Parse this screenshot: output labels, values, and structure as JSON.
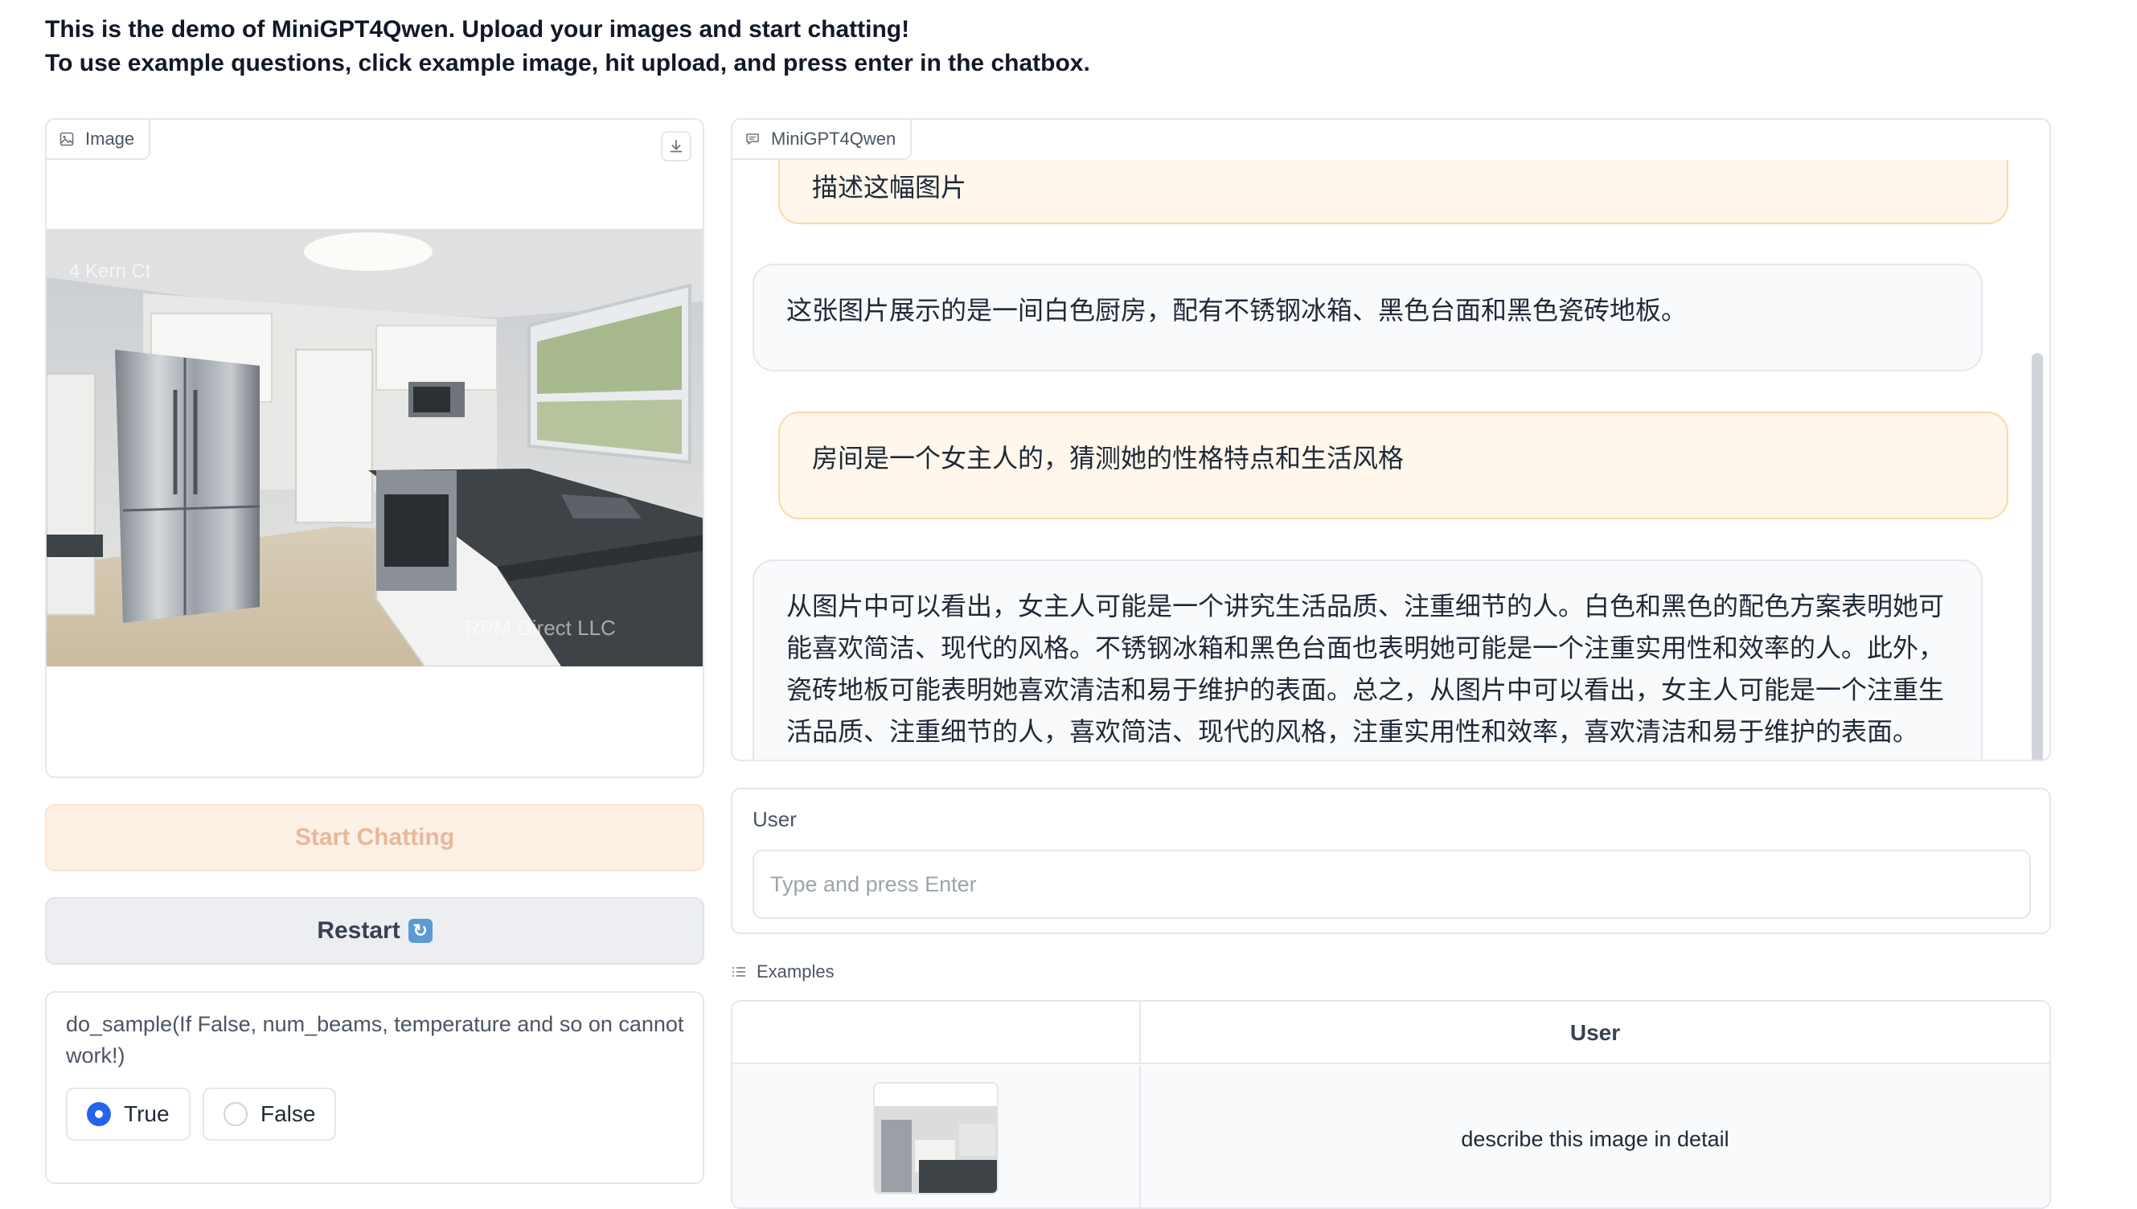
{
  "intro": {
    "line1": "This is the demo of MiniGPT4Qwen. Upload your images and start chatting!",
    "line2": "To use example questions, click example image, hit upload, and press enter in the chatbox."
  },
  "image_panel": {
    "label": "Image",
    "icons": [
      "image-icon",
      "download-icon"
    ]
  },
  "chatbot": {
    "label": "MiniGPT4Qwen",
    "messages": [
      {
        "role": "user",
        "text": "描述这幅图片"
      },
      {
        "role": "bot",
        "text": "这张图片展示的是一间白色厨房，配有不锈钢冰箱、黑色台面和黑色瓷砖地板。"
      },
      {
        "role": "user",
        "text": "房间是一个女主人的，猜测她的性格特点和生活风格"
      },
      {
        "role": "bot",
        "lines": [
          "从图片中可以看出，女主人可能是一个讲究生活品质、注重细节的人。白色和黑色的配色方案表明她可",
          "能喜欢简洁、现代的风格。不锈钢冰箱和黑色台面也表明她可能是一个注重实用性和效率的人。此外，",
          "瓷砖地板可能表明她喜欢清洁和易于维护的表面。总之，从图片中可以看出，女主人可能是一个注重生",
          "活品质、注重细节的人，喜欢简洁、现代的风格，注重实用性和效率，喜欢清洁和易于维护的表面。"
        ]
      }
    ]
  },
  "buttons": {
    "start": "Start Chatting",
    "restart": "Restart",
    "restart_emoji": "🔄"
  },
  "user_box": {
    "label": "User",
    "value": "",
    "placeholder": "Type and press Enter"
  },
  "do_sample": {
    "label": "do_sample(If False, num_beams, temperature and so on cannot work!)",
    "options": [
      "True",
      "False"
    ],
    "selected": "True"
  },
  "examples": {
    "label": "Examples",
    "headers": [
      "",
      "User"
    ],
    "rows": [
      {
        "user": "describe this image in detail"
      }
    ]
  }
}
